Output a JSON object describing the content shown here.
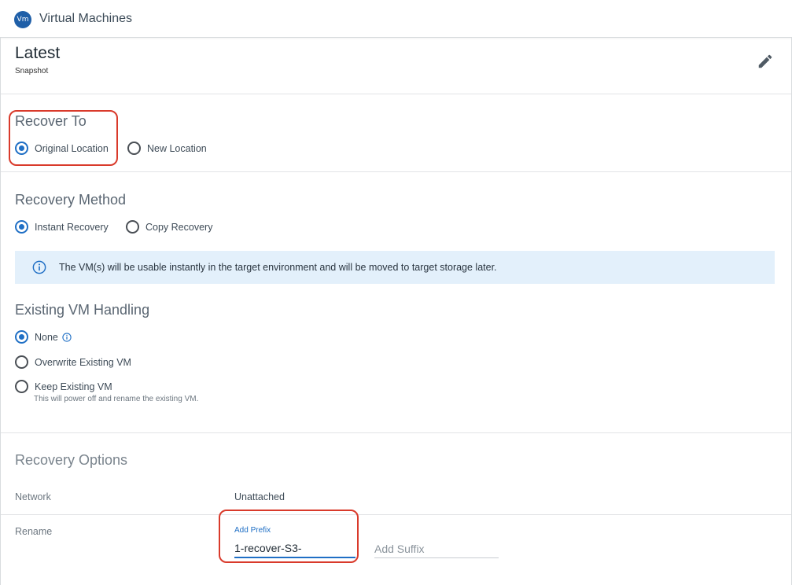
{
  "header": {
    "badge": "Vm",
    "title": "Virtual Machines"
  },
  "snapshot": {
    "title": "Latest",
    "subtitle": "Snapshot",
    "edit_icon": "pencil-icon"
  },
  "recover_to": {
    "title": "Recover To",
    "options": [
      {
        "label": "Original Location",
        "selected": true
      },
      {
        "label": "New Location",
        "selected": false
      }
    ]
  },
  "recovery_method": {
    "title": "Recovery Method",
    "options": [
      {
        "label": "Instant Recovery",
        "selected": true
      },
      {
        "label": "Copy Recovery",
        "selected": false
      }
    ],
    "info": "The VM(s) will be usable instantly in the target environment and will be moved to target storage later."
  },
  "existing_vm": {
    "title": "Existing VM Handling",
    "options": [
      {
        "label": "None",
        "selected": true
      },
      {
        "label": "Overwrite Existing VM",
        "selected": false
      },
      {
        "label": "Keep Existing VM",
        "selected": false
      }
    ],
    "keep_hint": "This will power off and rename the existing VM."
  },
  "recovery_options": {
    "title": "Recovery Options",
    "network_label": "Network",
    "network_value": "Unattached",
    "rename_label": "Rename",
    "prefix_label": "Add Prefix",
    "prefix_value": "1-recover-S3-",
    "suffix_placeholder": "Add Suffix"
  },
  "colors": {
    "accent": "#1f6fc5",
    "highlight": "#d93a2b",
    "info_bg": "#e3f0fb"
  }
}
